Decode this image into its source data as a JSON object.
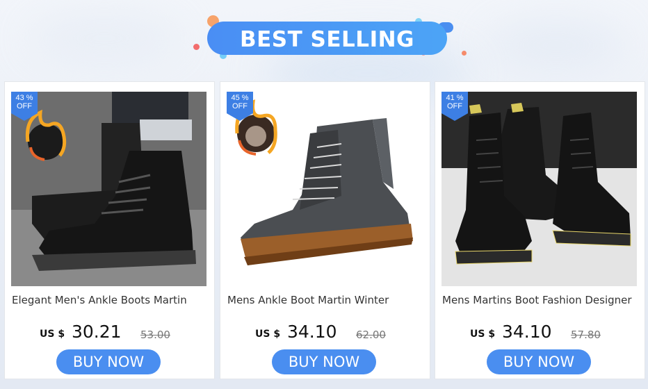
{
  "banner": {
    "title": "BEST SELLING"
  },
  "colors": {
    "accent": "#4a8ef0",
    "badge": "#3d7fe4",
    "flame": "#f5a623"
  },
  "products": [
    {
      "discount_pct": "43 %",
      "discount_off": "OFF",
      "title": "Elegant Men's Ankle Boots Martin",
      "currency": "US $",
      "price": "30.21",
      "old_price": "53.00",
      "button": "BUY NOW",
      "has_fur_icon": true
    },
    {
      "discount_pct": "45 %",
      "discount_off": "OFF",
      "title": "Mens Ankle Boot Martin Winter",
      "currency": "US $",
      "price": "34.10",
      "old_price": "62.00",
      "button": "BUY NOW",
      "has_fur_icon": true
    },
    {
      "discount_pct": "41 %",
      "discount_off": "OFF",
      "title": "Mens Martins Boot Fashion Designer",
      "currency": "US $",
      "price": "34.10",
      "old_price": "57.80",
      "button": "BUY NOW",
      "has_fur_icon": false
    }
  ]
}
